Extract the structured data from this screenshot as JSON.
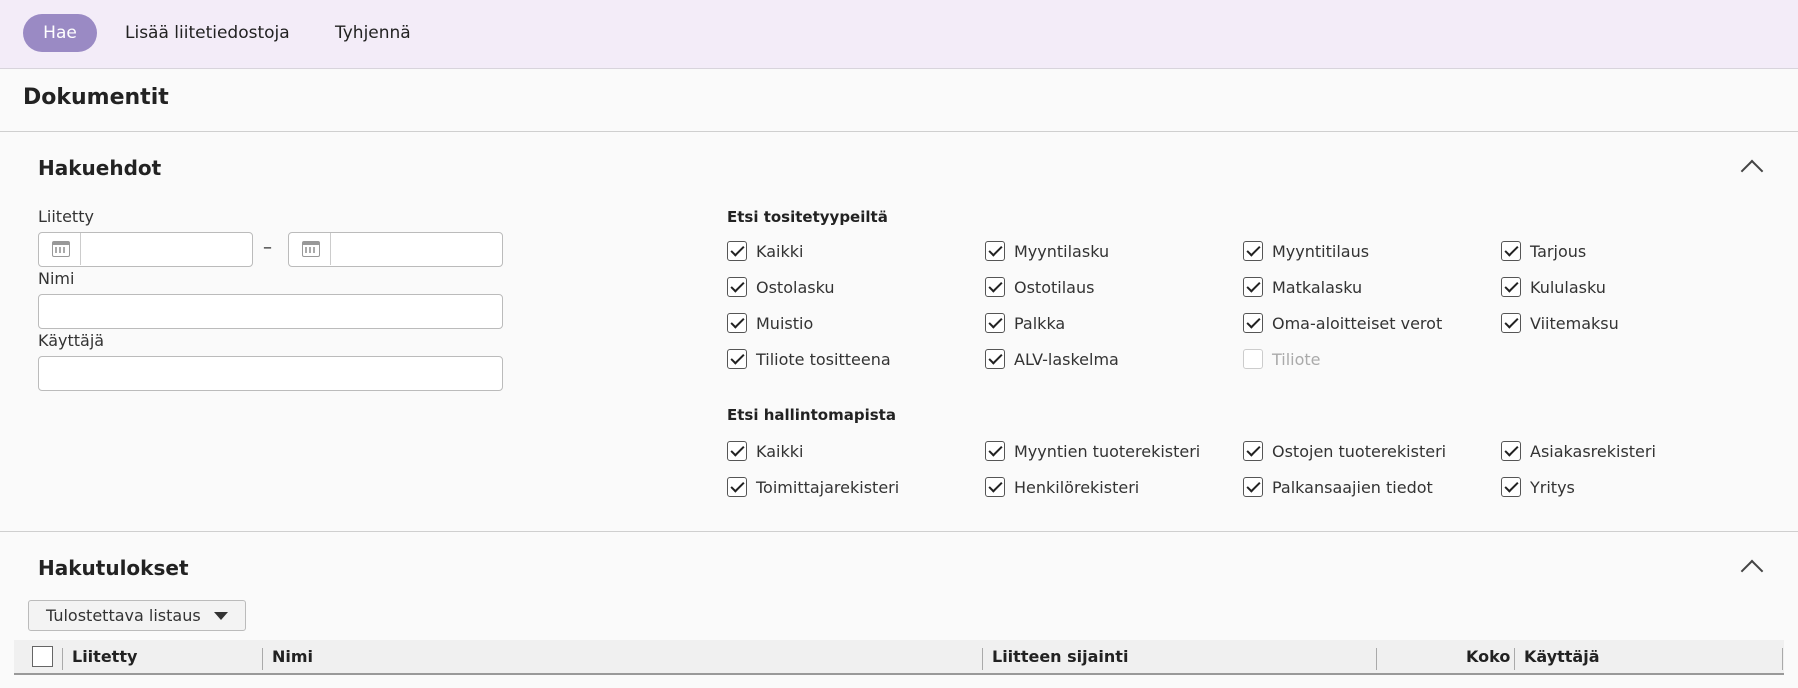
{
  "toolbar": {
    "search_label": "Hae",
    "add_attachments_label": "Lisää liitetiedostoja",
    "clear_label": "Tyhjennä"
  },
  "page_title": "Dokumentit",
  "search_criteria": {
    "title": "Hakuehdot",
    "attached_label": "Liitetty",
    "date_from_value": "",
    "date_to_value": "",
    "date_separator": "–",
    "name_label": "Nimi",
    "name_value": "",
    "user_label": "Käyttäjä",
    "user_value": ""
  },
  "voucher_types": {
    "label": "Etsi tositetyypeiltä",
    "items": [
      {
        "label": "Kaikki",
        "checked": true
      },
      {
        "label": "Myyntilasku",
        "checked": true
      },
      {
        "label": "Myyntitilaus",
        "checked": true
      },
      {
        "label": "Tarjous",
        "checked": true
      },
      {
        "label": "Ostolasku",
        "checked": true
      },
      {
        "label": "Ostotilaus",
        "checked": true
      },
      {
        "label": "Matkalasku",
        "checked": true
      },
      {
        "label": "Kululasku",
        "checked": true
      },
      {
        "label": "Muistio",
        "checked": true
      },
      {
        "label": "Palkka",
        "checked": true
      },
      {
        "label": "Oma-aloitteiset verot",
        "checked": true
      },
      {
        "label": "Viitemaksu",
        "checked": true
      },
      {
        "label": "Tiliote tositteena",
        "checked": true
      },
      {
        "label": "ALV-laskelma",
        "checked": true
      },
      {
        "label": "Tiliote",
        "checked": false,
        "disabled": true
      }
    ]
  },
  "admin_maps": {
    "label": "Etsi hallintomapista",
    "items": [
      {
        "label": "Kaikki",
        "checked": true
      },
      {
        "label": "Myyntien tuoterekisteri",
        "checked": true
      },
      {
        "label": "Ostojen tuoterekisteri",
        "checked": true
      },
      {
        "label": "Asiakasrekisteri",
        "checked": true
      },
      {
        "label": "Toimittajarekisteri",
        "checked": true
      },
      {
        "label": "Henkilörekisteri",
        "checked": true
      },
      {
        "label": "Palkansaajien tiedot",
        "checked": true
      },
      {
        "label": "Yritys",
        "checked": true
      }
    ]
  },
  "results": {
    "title": "Hakutulokset",
    "print_list_label": "Tulostettava listaus",
    "columns": [
      "Liitetty",
      "Nimi",
      "Liitteen sijainti",
      "Koko",
      "Käyttäjä"
    ]
  }
}
